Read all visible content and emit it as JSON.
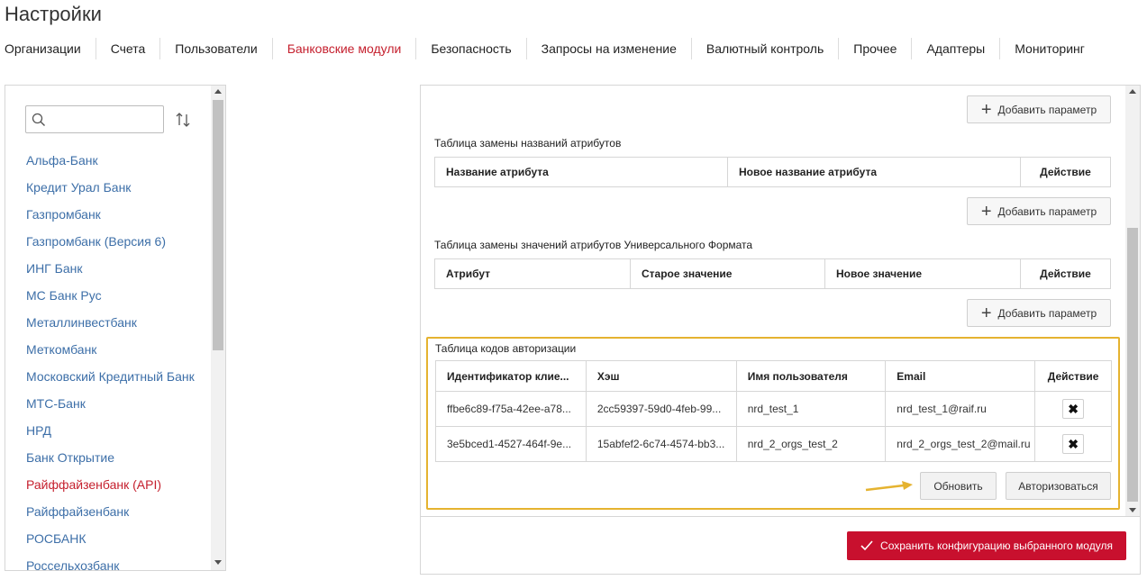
{
  "page": {
    "title": "Настройки"
  },
  "tabs": [
    {
      "label": "Организации"
    },
    {
      "label": "Счета"
    },
    {
      "label": "Пользователи"
    },
    {
      "label": "Банковские модули"
    },
    {
      "label": "Безопасность"
    },
    {
      "label": "Запросы на изменение"
    },
    {
      "label": "Валютный контроль"
    },
    {
      "label": "Прочее"
    },
    {
      "label": "Адаптеры"
    },
    {
      "label": "Мониторинг"
    }
  ],
  "active_tab": "Банковские модули",
  "sidebar": {
    "search": {
      "value": "",
      "placeholder": ""
    },
    "banks": [
      "Альфа-Банк",
      "Кредит Урал Банк",
      "Газпромбанк",
      "Газпромбанк (Версия 6)",
      "ИНГ Банк",
      "МС Банк Рус",
      "Металлинвестбанк",
      "Меткомбанк",
      "Московский Кредитный Банк",
      "МТС-Банк",
      "НРД",
      "Банк Открытие",
      "Райффайзенбанк (API)",
      "Райффайзенбанк",
      "РОСБАНК",
      "Россельхозбанк"
    ],
    "active_bank": "Райффайзенбанк (API)"
  },
  "main": {
    "add_param_label": "Добавить параметр",
    "attr_names_table": {
      "title": "Таблица замены названий атрибутов",
      "columns": [
        "Название атрибута",
        "Новое название атрибута",
        "Действие"
      ]
    },
    "attr_values_table": {
      "title": "Таблица замены значений атрибутов Универсального Формата",
      "columns": [
        "Атрибут",
        "Старое значение",
        "Новое значение",
        "Действие"
      ]
    },
    "auth_codes": {
      "title": "Таблица кодов авторизации",
      "columns": [
        "Идентификатор клие...",
        "Хэш",
        "Имя пользователя",
        "Email",
        "Действие"
      ],
      "rows": [
        [
          "ffbe6c89-f75a-42ee-a78...",
          "2cc59397-59d0-4feb-99...",
          "nrd_test_1",
          "nrd_test_1@raif.ru"
        ],
        [
          "3e5bced1-4527-464f-9e...",
          "15abfef2-6c74-4574-bb3...",
          "nrd_2_orgs_test_2",
          "nrd_2_orgs_test_2@mail.ru"
        ]
      ],
      "delete_icon": "close-icon",
      "refresh_label": "Обновить",
      "authorize_label": "Авторизоваться"
    },
    "save_label": "Сохранить конфигурацию выбранного модуля"
  },
  "colors": {
    "accent_red": "#c8102e",
    "link_blue": "#3d6fa8",
    "highlight_border": "#e5b330",
    "arrow": "#e5b330"
  }
}
